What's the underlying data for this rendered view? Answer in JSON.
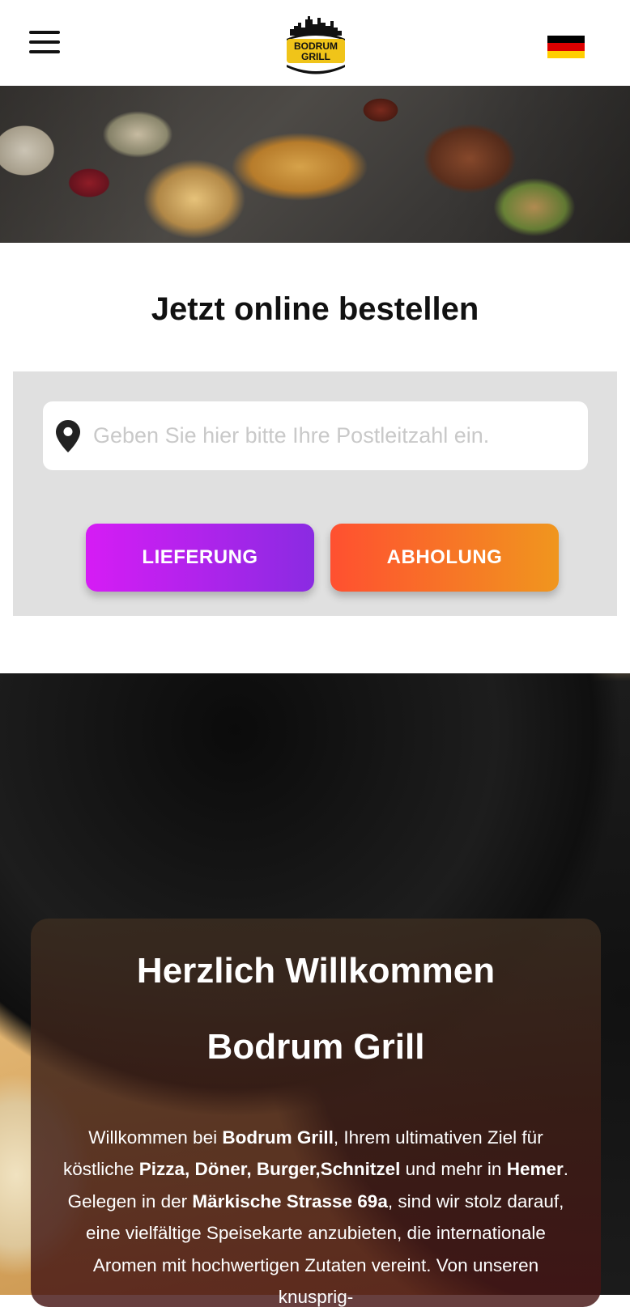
{
  "header": {
    "logo_text_1": "BODRUM",
    "logo_text_2": "GRILL",
    "menu_icon": "hamburger-menu-icon",
    "language_flag": "german-flag-icon"
  },
  "order": {
    "title": "Jetzt online bestellen",
    "zip_placeholder": "Geben Sie hier bitte Ihre Postleitzahl ein.",
    "delivery_label": "LIEFERUNG",
    "pickup_label": "ABHOLUNG"
  },
  "welcome": {
    "heading_1": "Herzlich Willkommen",
    "heading_2": "Bodrum Grill",
    "segments": [
      "Willkommen bei ",
      "Bodrum Grill",
      ", Ihrem ultimativen Ziel für köstliche ",
      "Pizza, Döner, Burger,Schnitzel",
      " und mehr in ",
      "Hemer",
      ". Gelegen in der ",
      "Märkische Strasse 69a",
      ", sind wir stolz darauf, eine vielfältige Speisekarte anzubieten, die internationale Aromen mit hochwertigen Zutaten vereint. Von unseren knusprig-"
    ]
  },
  "colors": {
    "delivery_gradient": [
      "#d61cf5",
      "#8a2be2"
    ],
    "pickup_gradient": [
      "#ff5030",
      "#f0961e"
    ],
    "order_box_bg": "#e0e0e0"
  }
}
